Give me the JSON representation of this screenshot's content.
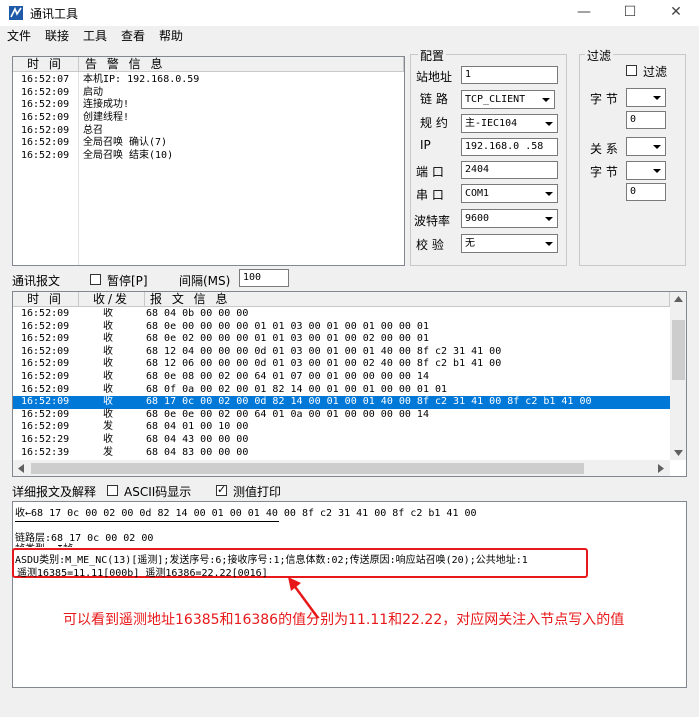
{
  "window": {
    "title": "通讯工具"
  },
  "menu": [
    "文件",
    "联接",
    "工具",
    "查看",
    "帮助"
  ],
  "alarm_log": {
    "headers": [
      "时 间",
      "告 警 信 息"
    ],
    "rows": [
      [
        "16:52:07",
        "本机IP: 192.168.0.59"
      ],
      [
        "16:52:09",
        "启动"
      ],
      [
        "16:52:09",
        "连接成功!"
      ],
      [
        "16:52:09",
        "创建线程!"
      ],
      [
        "16:52:09",
        "总召"
      ],
      [
        "16:52:09",
        "全局召唤 确认(7)"
      ],
      [
        "16:52:09",
        "全局召唤 结束(10)"
      ]
    ]
  },
  "config": {
    "title": "配置",
    "station_label": "站地址",
    "station_value": "1",
    "link_label": "链 路",
    "link_value": "TCP_CLIENT",
    "protocol_label": "规 约",
    "protocol_value": "主-IEC104",
    "ip_label": "IP",
    "ip_value": "192.168.0 .58",
    "port_label": "端 口",
    "port_value": "2404",
    "serial_label": "串 口",
    "serial_value": "COM1",
    "baud_label": "波特率",
    "baud_value": "9600",
    "parity_label": "校 验",
    "parity_value": "无"
  },
  "filter": {
    "title": "过滤",
    "filter_label": "过滤",
    "byte_label": "字 节",
    "relation_label": "关 系",
    "byte2_label": "字 节",
    "value1": "0",
    "value2": "0"
  },
  "comm": {
    "label": "通讯报文",
    "pause_label": "暂停[P]",
    "interval_label": "间隔(MS)",
    "interval_value": "100",
    "headers": [
      "时 间",
      "收/发",
      "报 文 信 息"
    ],
    "rows": [
      [
        "16:52:09",
        "收",
        "68 04 0b 00 00 00"
      ],
      [
        "16:52:09",
        "收",
        "68 0e 00 00 00 00 01 01 03 00 01 00 01 00 00 01"
      ],
      [
        "16:52:09",
        "收",
        "68 0e 02 00 00 00 01 01 03 00 01 00 02 00 00 01"
      ],
      [
        "16:52:09",
        "收",
        "68 12 04 00 00 00 0d 01 03 00 01 00 01 40 00 8f c2 31 41 00"
      ],
      [
        "16:52:09",
        "收",
        "68 12 06 00 00 00 0d 01 03 00 01 00 02 40 00 8f c2 b1 41 00"
      ],
      [
        "16:52:09",
        "收",
        "68 0e 08 00 02 00 64 01 07 00 01 00 00 00 00 14"
      ],
      [
        "16:52:09",
        "收",
        "68 0f 0a 00 02 00 01 82 14 00 01 00 01 00 00 01 01"
      ],
      [
        "16:52:09",
        "收",
        "68 17 0c 00 02 00 0d 82 14 00 01 00 01 40 00 8f c2 31 41 00 8f c2 b1 41 00"
      ],
      [
        "16:52:09",
        "收",
        "68 0e 0e 00 02 00 64 01 0a 00 01 00 00 00 00 14"
      ],
      [
        "16:52:09",
        "发",
        "68 04 01 00 10 00"
      ],
      [
        "16:52:29",
        "收",
        "68 04 43 00 00 00"
      ],
      [
        "16:52:39",
        "发",
        "68 04 83 00 00 00"
      ]
    ],
    "selected_index": 7
  },
  "detail": {
    "label": "详细报文及解释",
    "ascii_label": "ASCII码显示",
    "print_label": "测值打印",
    "line1": "收←68 17 0c 00 02 00 0d 82 14 00 01 00 01 40 00 8f c2 31 41 00 8f c2 b1 41 00",
    "line2": "链路层:68 17 0c 00 02 00",
    "line3": "帧类型: I帧",
    "asdu_line": "ASDU类别:M_ME_NC(13)[遥测];发送序号:6;接收序号:1;信息体数:02;传送原因:响应站召唤(20);公共地址:1",
    "values_line": "遥测16385=11.11[000b] 遥测16386=22.22[0016]",
    "annotation": "可以看到遥测地址16385和16386的值分别为11.11和22.22，对应网关注入节点写入的值"
  },
  "colors": {
    "selected": "#0078d7",
    "annotation": "#e8181a"
  }
}
